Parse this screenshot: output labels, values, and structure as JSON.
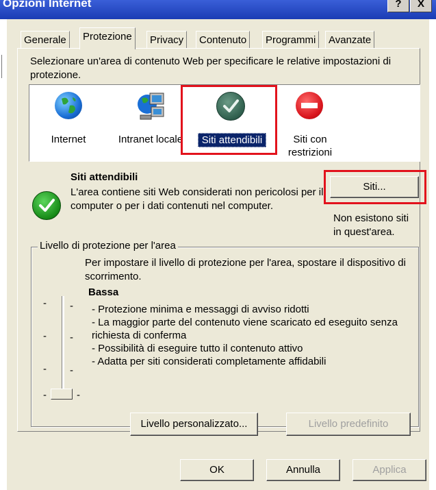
{
  "window": {
    "title": "Opzioni Internet",
    "help_glyph": "?",
    "close_glyph": "X"
  },
  "tabs": [
    {
      "label": "Generale"
    },
    {
      "label": "Protezione",
      "active": true
    },
    {
      "label": "Privacy"
    },
    {
      "label": "Contenuto"
    },
    {
      "label": "Programmi"
    },
    {
      "label": "Avanzate"
    }
  ],
  "instruction": "Selezionare un'area di contenuto Web per specificare le relative impostazioni di protezione.",
  "zones": [
    {
      "label": "Internet",
      "icon": "globe-icon"
    },
    {
      "label": "Intranet locale",
      "icon": "network-computer-icon"
    },
    {
      "label": "Siti attendibili",
      "icon": "trusted-check-icon",
      "selected": true
    },
    {
      "label": "Siti con restrizioni",
      "icon": "restricted-icon"
    }
  ],
  "zone_details": {
    "title": "Siti attendibili",
    "description": "L'area contiene siti Web considerati non pericolosi per il computer o per i dati contenuti nel computer.",
    "sites_button": "Siti...",
    "no_sites_note": "Non esistono siti in quest'area."
  },
  "security_level": {
    "group_label": "Livello di protezione per l'area",
    "instruction": "Per impostare il livello di protezione per l'area, spostare il dispositivo di scorrimento.",
    "level_name": "Bassa",
    "bullets": [
      "- Protezione minima e messaggi di avviso ridotti",
      "- La maggior parte del contenuto viene scaricato ed eseguito senza richiesta di conferma",
      "- Possibilità di eseguire tutto il contenuto attivo",
      "- Adatta per siti considerati completamente affidabili"
    ],
    "slider_tick_marks": [
      "-",
      "-",
      "-",
      "-"
    ],
    "custom_level_button": "Livello personalizzato...",
    "default_level_button": "Livello predefinito"
  },
  "footer": {
    "ok": "OK",
    "cancel": "Annulla",
    "apply": "Applica"
  },
  "colors": {
    "highlight": "#e2121c",
    "selection": "#0a246a",
    "dialog_bg": "#ece9d8"
  }
}
